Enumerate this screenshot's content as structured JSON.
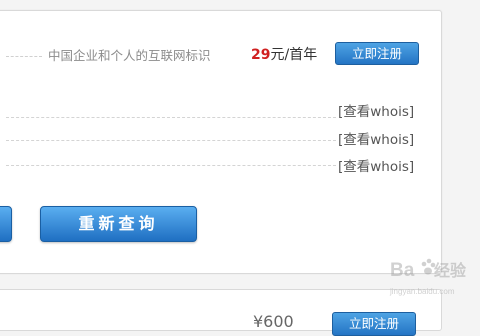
{
  "domain_row": {
    "description": "中国企业和个人的互联网标识",
    "price_value": "29",
    "price_unit": "元/首年",
    "register_label": "立即注册"
  },
  "whois_links": [
    "[查看whois]",
    "[查看whois]",
    "[查看whois]"
  ],
  "actions": {
    "requery_label": "重新查询"
  },
  "next_row": {
    "price": "¥600",
    "register_label": "立即注册"
  },
  "watermark": {
    "text": "Baidu经验",
    "subtext": "jingyan.baidu.com"
  }
}
